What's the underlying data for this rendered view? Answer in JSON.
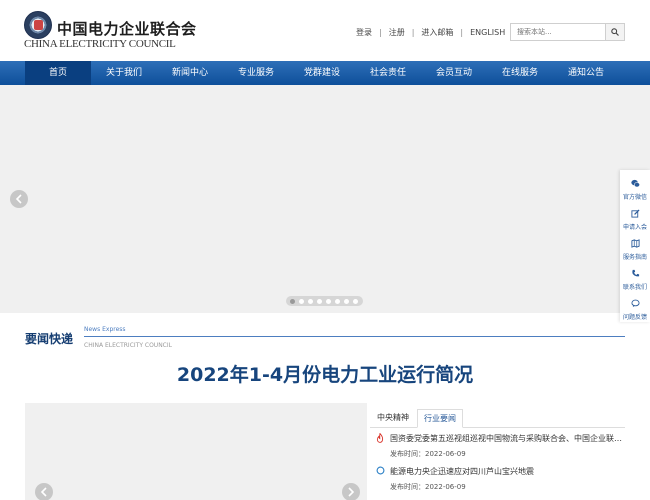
{
  "header": {
    "logo_cn": "中国电力企业联合会",
    "logo_en": "CHINA ELECTRICITY COUNCIL",
    "links": [
      "登录",
      "注册",
      "进入邮箱",
      "ENGLISH"
    ],
    "search_placeholder": "搜索本站..."
  },
  "nav": {
    "items": [
      "首页",
      "关于我们",
      "新闻中心",
      "专业服务",
      "党群建设",
      "社会责任",
      "会员互动",
      "在线服务",
      "通知公告"
    ],
    "active_index": 0
  },
  "sidebar": {
    "items": [
      {
        "label": "官方微信",
        "icon": "wechat-icon"
      },
      {
        "label": "申请入会",
        "icon": "edit-icon"
      },
      {
        "label": "服务指南",
        "icon": "map-icon"
      },
      {
        "label": "联系我们",
        "icon": "phone-icon"
      },
      {
        "label": "问题反馈",
        "icon": "chat-icon"
      }
    ]
  },
  "news_section": {
    "title": "要闻快递",
    "subtitle_en": "News Express",
    "subtitle_en2": "CHINA  ELECTRICITY COUNCIL",
    "headline": "2022年1-4月份电力工业运行简况",
    "tabs": [
      "中央精神",
      "行业要闻"
    ],
    "items": [
      {
        "title": "国资委党委第五巡视组巡视中国物流与采购联合会、中国企业联合会",
        "date": "发布时间：2022-06-09"
      },
      {
        "title": "能源电力央企迅速应对四川芦山宝兴地震",
        "date": "发布时间：2022-06-09"
      }
    ]
  },
  "colors": {
    "nav_blue": "#0e4f9a",
    "headline_blue": "#17457d",
    "accent_red": "#d9342b"
  }
}
